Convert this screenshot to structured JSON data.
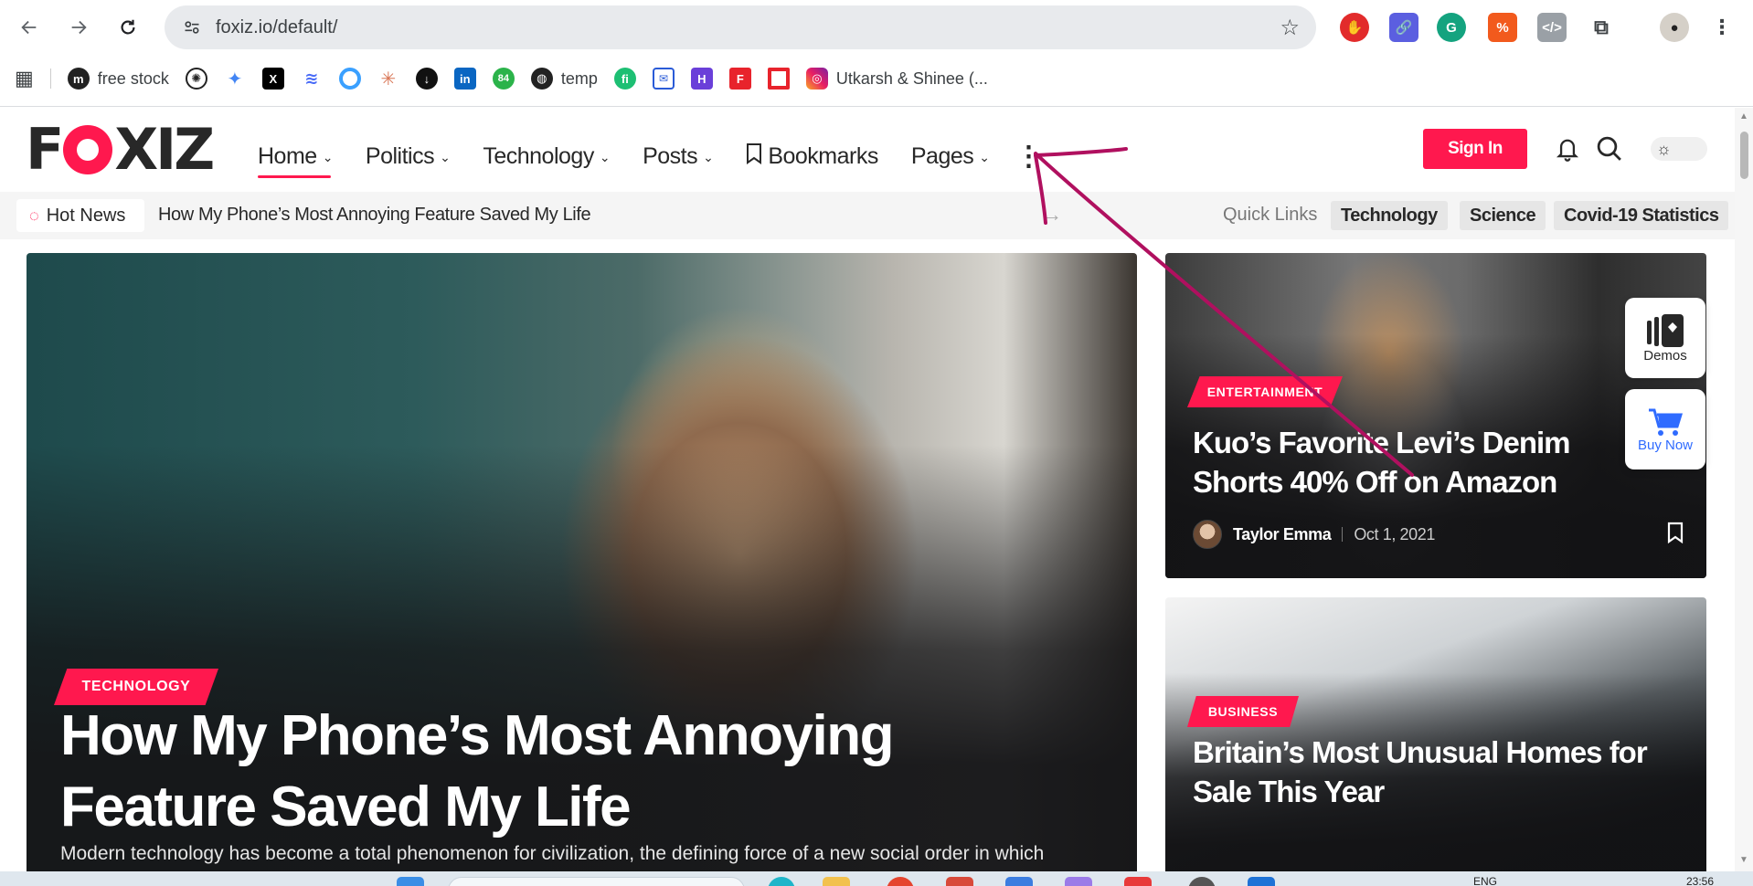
{
  "browser": {
    "url": "foxiz.io/default/",
    "extensions": [
      "ublock-icon",
      "link-icon",
      "grammarly-icon",
      "tampermonkey-icon",
      "code-icon",
      "puzzle-icon"
    ],
    "bookmarks": [
      {
        "label": "",
        "icon": "apps-grid-icon"
      },
      {
        "label": "free stock",
        "icon": "m-icon"
      },
      {
        "label": "",
        "icon": "openai-icon"
      },
      {
        "label": "",
        "icon": "gemini-icon"
      },
      {
        "label": "",
        "icon": "x-icon"
      },
      {
        "label": "",
        "icon": "wave-icon"
      },
      {
        "label": "",
        "icon": "ring-icon"
      },
      {
        "label": "",
        "icon": "claude-icon"
      },
      {
        "label": "",
        "icon": "download-icon"
      },
      {
        "label": "",
        "icon": "linkedin-icon"
      },
      {
        "label": "84",
        "icon": "badge-84-icon"
      },
      {
        "label": "temp",
        "icon": "globe-icon"
      },
      {
        "label": "",
        "icon": "fiverr-icon"
      },
      {
        "label": "",
        "icon": "mail-icon"
      },
      {
        "label": "",
        "icon": "h-icon"
      },
      {
        "label": "",
        "icon": "f-icon"
      },
      {
        "label": "",
        "icon": "red-square-icon"
      },
      {
        "label": "Utkarsh & Shinee (...",
        "icon": "instagram-icon"
      }
    ]
  },
  "site": {
    "logo": "FOXIZ",
    "nav": [
      {
        "label": "Home",
        "active": true,
        "dropdown": true
      },
      {
        "label": "Politics",
        "dropdown": true
      },
      {
        "label": "Technology",
        "dropdown": true
      },
      {
        "label": "Posts",
        "dropdown": true
      },
      {
        "label": "Bookmarks",
        "dropdown": false
      },
      {
        "label": "Pages",
        "dropdown": true
      }
    ],
    "signin": "Sign In",
    "hot_label": "Hot News",
    "hot_headline": "How My Phone’s Most Annoying Feature Saved My Life",
    "quick_links_label": "Quick Links",
    "quick_links": [
      "Technology",
      "Science",
      "Covid-19 Statistics"
    ]
  },
  "hero": {
    "category": "TECHNOLOGY",
    "title": "How My Phone’s Most Annoying Feature Saved My Life",
    "excerpt": "Modern technology has become a total phenomenon for civilization, the defining force of a new social order in which efficiency is no longer an option but a necessity imposed on all human activity."
  },
  "cards": [
    {
      "category": "ENTERTAINMENT",
      "title": "Kuo’s Favorite Levi’s Denim Shorts 40% Off on Amazon",
      "author": "Taylor Emma",
      "date": "Oct 1, 2021"
    },
    {
      "category": "BUSINESS",
      "title": "Britain’s Most Unusual Homes for Sale This Year"
    }
  ],
  "widgets": {
    "demos": "Demos",
    "buy": "Buy Now"
  },
  "taskbar": {
    "lang": "ENG",
    "time": "23:56"
  },
  "colors": {
    "accent": "#ff184e",
    "annotation": "#b0105f"
  }
}
